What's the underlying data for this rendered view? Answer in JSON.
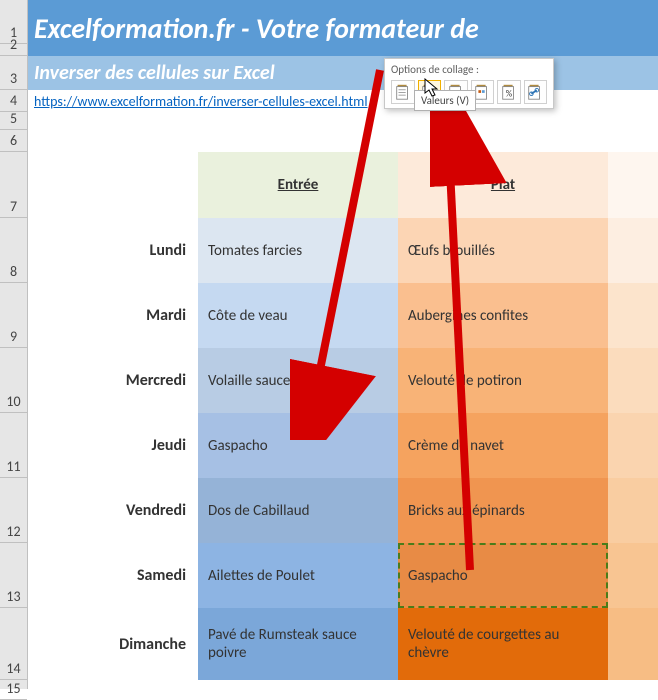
{
  "title": "Excelformation.fr - Votre formateur de",
  "subtitle": "Inverser des cellules sur Excel",
  "link_text": "https://www.excelformation.fr/inverser-cellules-excel.html",
  "link_href": "https://www.excelformation.fr/inverser-cellules-excel.html",
  "headers": {
    "entree": "Entrée",
    "plat": "Plat"
  },
  "rows": [
    {
      "day": "Lundi",
      "entree": "Tomates farcies",
      "plat": "Œufs brouillés"
    },
    {
      "day": "Mardi",
      "entree": "Côte de veau",
      "plat": "Aubergines confites"
    },
    {
      "day": "Mercredi",
      "entree": "Volaille sauce moutarde",
      "plat": "Velouté de potiron"
    },
    {
      "day": "Jeudi",
      "entree": "Gaspacho",
      "plat": "Crème de navet"
    },
    {
      "day": "Vendredi",
      "entree": "Dos de Cabillaud",
      "plat": "Bricks aux épinards"
    },
    {
      "day": "Samedi",
      "entree": "Ailettes de Poulet",
      "plat": "Gaspacho"
    },
    {
      "day": "Dimanche",
      "entree": "Pavé de Rumsteak sauce poivre",
      "plat": "Velouté de courgettes au chèvre"
    }
  ],
  "row_numbers": [
    "1",
    "2",
    "3",
    "4",
    "5",
    "6",
    "7",
    "8",
    "9",
    "10",
    "11",
    "12",
    "13",
    "14",
    "15"
  ],
  "paste_options": {
    "title": "Options de collage :",
    "tooltip": "Valeurs (V)",
    "icons": [
      "paste-all",
      "paste-values",
      "paste-formulas",
      "paste-formatting",
      "paste-percent",
      "paste-link"
    ]
  }
}
